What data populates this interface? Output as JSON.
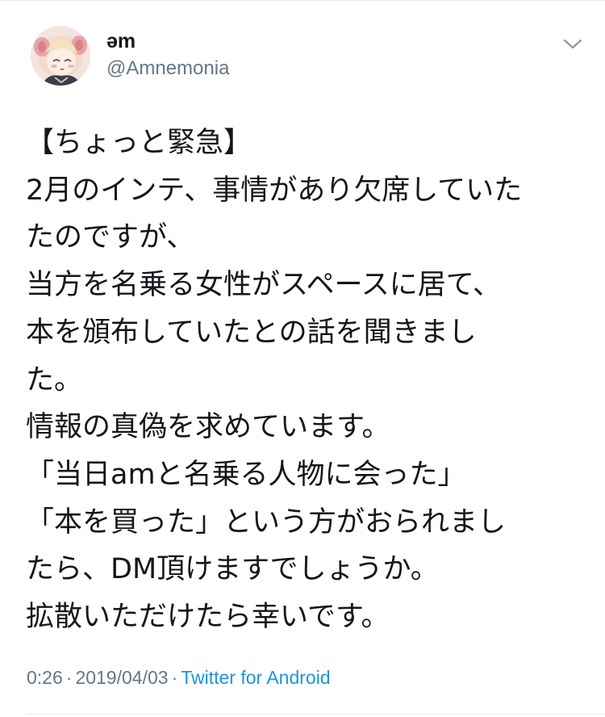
{
  "tweet": {
    "author": {
      "display_name": "əm",
      "handle": "@Amnemonia",
      "avatar": "avatar-anime-character"
    },
    "menu_icon": "chevron-down-icon",
    "lines": [
      "【ちょっと緊急】",
      "2月のインテ、事情があり欠席していた",
      "たのですが、",
      "当方を名乗る女性がスペースに居て、",
      "本を頒布していたとの話を聞きまし",
      "た。",
      "情報の真偽を求めています。",
      "「当日amと名乗る人物に会った」",
      "「本を買った」という方がおられまし",
      "たら、DM頂けますでしょうか。",
      "拡散いただけたら幸いです。"
    ],
    "meta": {
      "time": "0:26",
      "separator": "·",
      "date": "2019/04/03",
      "source": "Twitter for Android"
    }
  },
  "colors": {
    "text": "#14171a",
    "secondary": "#657786",
    "link": "#1b95e0",
    "divider": "#e6ecf0"
  }
}
